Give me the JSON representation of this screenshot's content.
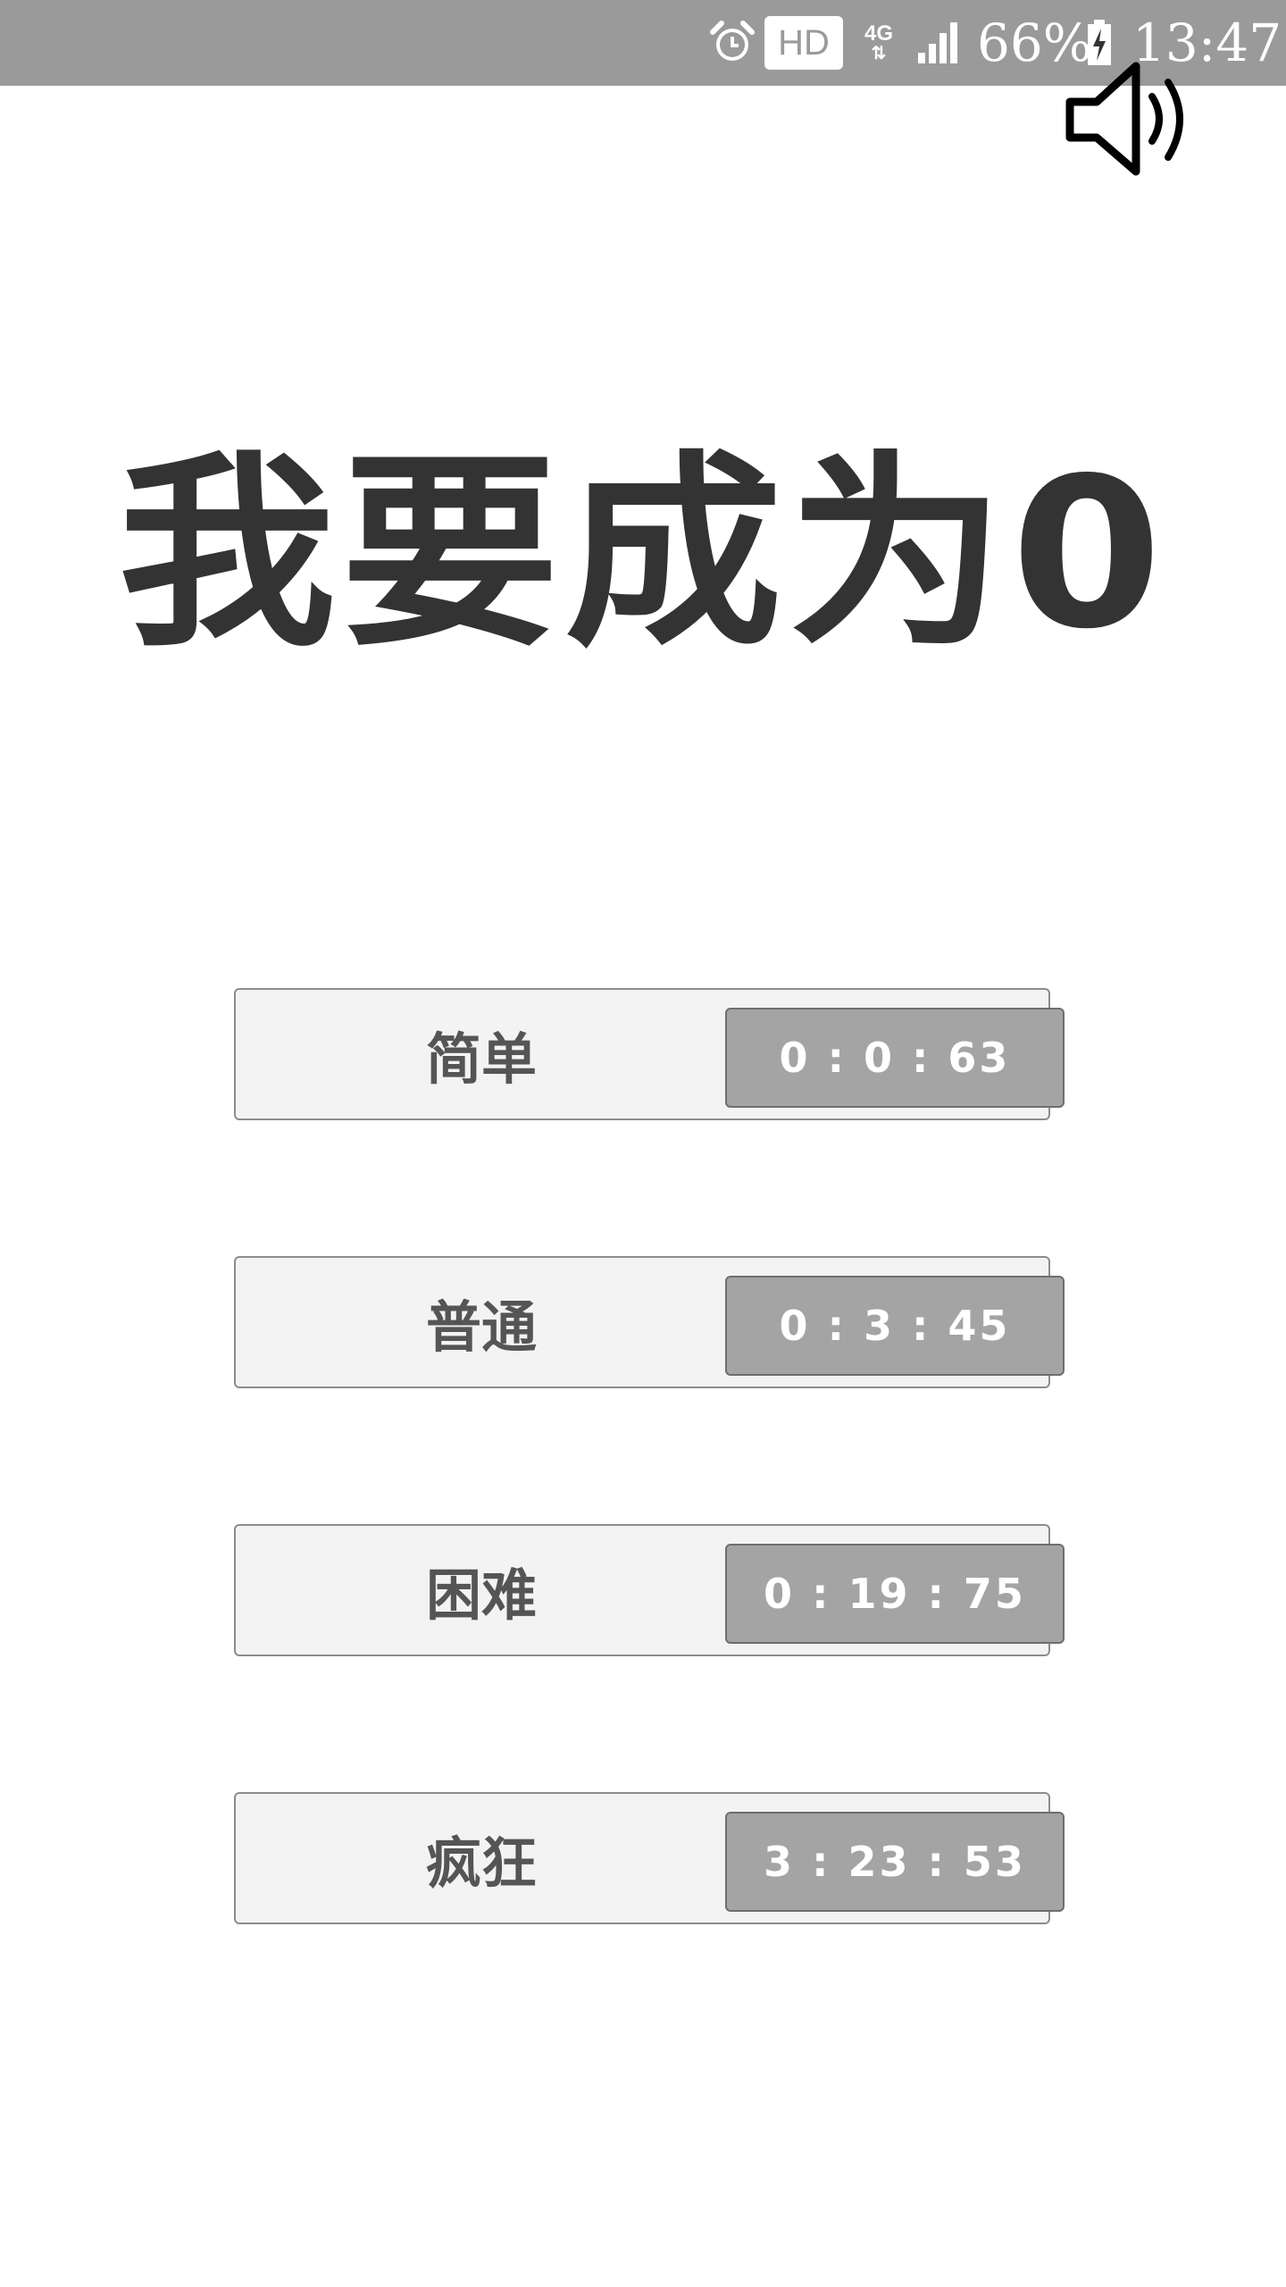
{
  "status_bar": {
    "alarm_icon": "alarm-clock-icon",
    "hd_badge": "HD",
    "network_type": "4G",
    "network_arrows": "⇅",
    "signal_icon": "signal-bars-icon",
    "battery_percent": "66%",
    "battery_icon": "battery-charging-icon",
    "time": "13:47",
    "background_color": "#9a9a9a"
  },
  "speaker": {
    "icon": "speaker-volume-icon"
  },
  "title": "我要成为0",
  "levels": [
    {
      "name": "简单",
      "time": "0 : 0 : 63"
    },
    {
      "name": "普通",
      "time": "0 : 3 : 45"
    },
    {
      "name": "困难",
      "time": "0 : 19 : 75"
    },
    {
      "name": "疯狂",
      "time": "3 : 23 : 53"
    }
  ],
  "colors": {
    "title": "#333333",
    "button_bg": "#f3f3f3",
    "time_badge_bg": "#a4a4a4",
    "label": "#555555"
  }
}
